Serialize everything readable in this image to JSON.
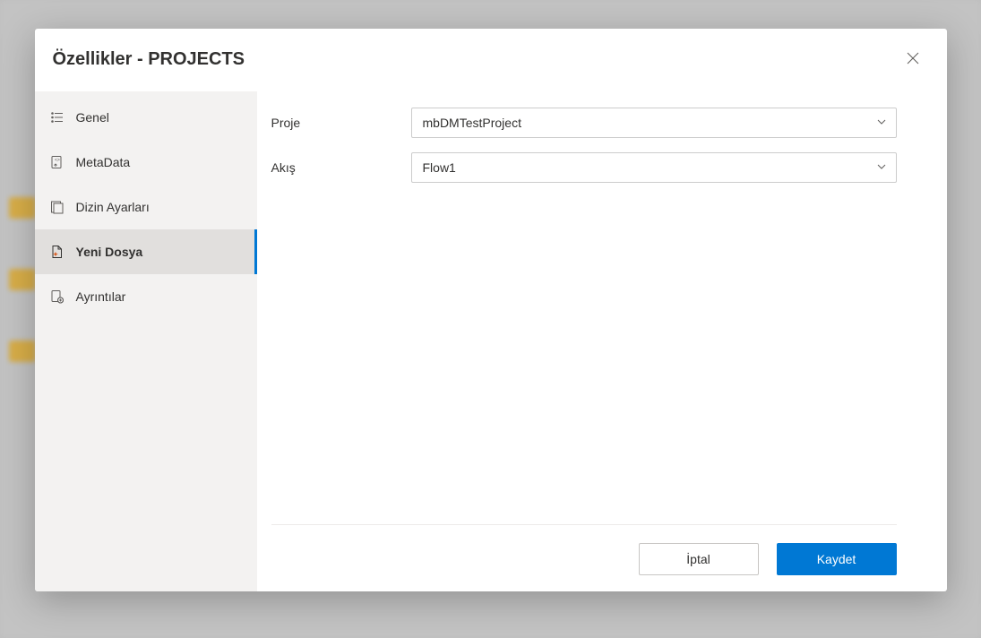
{
  "modal": {
    "title": "Özellikler - PROJECTS"
  },
  "sidebar": {
    "items": [
      {
        "label": "Genel",
        "icon": "list-icon"
      },
      {
        "label": "MetaData",
        "icon": "metadata-icon"
      },
      {
        "label": "Dizin Ayarları",
        "icon": "folder-settings-icon"
      },
      {
        "label": "Yeni Dosya",
        "icon": "new-file-icon"
      },
      {
        "label": "Ayrıntılar",
        "icon": "details-icon"
      }
    ],
    "activeIndex": 3
  },
  "form": {
    "project": {
      "label": "Proje",
      "value": "mbDMTestProject"
    },
    "flow": {
      "label": "Akış",
      "value": "Flow1"
    }
  },
  "footer": {
    "cancel": "İptal",
    "save": "Kaydet"
  },
  "colors": {
    "primary": "#0078d4",
    "sidebarBg": "#f3f2f1",
    "sidebarActive": "#e1dfdd"
  }
}
